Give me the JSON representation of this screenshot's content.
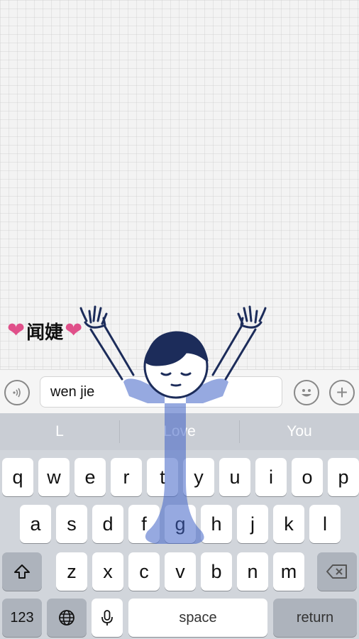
{
  "chat": {
    "contact_name": "闻婕",
    "heart_left": "❤",
    "heart_right": "❤"
  },
  "input_bar": {
    "text_value": "wen jie",
    "voice_icon": "voice-wave-icon",
    "emoji_icon": "smiley-icon",
    "plus_label": "+"
  },
  "keyboard": {
    "suggestions": [
      "L",
      "Love",
      "You"
    ],
    "row1": [
      "q",
      "w",
      "e",
      "r",
      "t",
      "y",
      "u",
      "i",
      "o",
      "p"
    ],
    "row2": [
      "a",
      "s",
      "d",
      "f",
      "g",
      "h",
      "j",
      "k",
      "l"
    ],
    "row3": [
      "z",
      "x",
      "c",
      "v",
      "b",
      "n",
      "m"
    ],
    "numbers_key": "123",
    "space_key": "space",
    "return_key": "return",
    "shift_icon": "shift-arrow-icon",
    "delete_icon": "backspace-icon",
    "globe_icon": "globe-icon",
    "mic_icon": "microphone-icon"
  }
}
